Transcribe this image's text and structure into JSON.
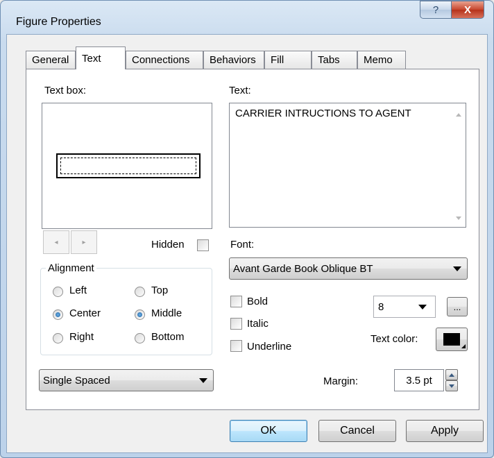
{
  "window": {
    "title": "Figure Properties",
    "help_label": "?",
    "close_label": "X"
  },
  "tabs": [
    "General",
    "Text",
    "Connections",
    "Behaviors",
    "Fill",
    "Tabs",
    "Memo"
  ],
  "text_box": {
    "label": "Text box:",
    "hidden_label": "Hidden",
    "hidden_checked": false,
    "prev_glyph": "◂",
    "next_glyph": "▸"
  },
  "alignment": {
    "legend": "Alignment",
    "horizontal": [
      "Left",
      "Center",
      "Right"
    ],
    "vertical": [
      "Top",
      "Middle",
      "Bottom"
    ],
    "selected_horizontal": "Center",
    "selected_vertical": "Middle"
  },
  "spacing": {
    "selected": "Single Spaced"
  },
  "text": {
    "label": "Text:",
    "value": "CARRIER INTRUCTIONS TO AGENT"
  },
  "font": {
    "label": "Font:",
    "selected": "Avant Garde Book Oblique BT"
  },
  "styles": {
    "bold": "Bold",
    "italic": "Italic",
    "underline": "Underline",
    "bold_checked": false,
    "italic_checked": false,
    "underline_checked": false
  },
  "size": {
    "value": "8",
    "more_label": "..."
  },
  "text_color": {
    "label": "Text color:",
    "color": "#000000"
  },
  "margin": {
    "label": "Margin:",
    "value": "3.5 pt"
  },
  "buttons": {
    "ok": "OK",
    "cancel": "Cancel",
    "apply": "Apply"
  }
}
